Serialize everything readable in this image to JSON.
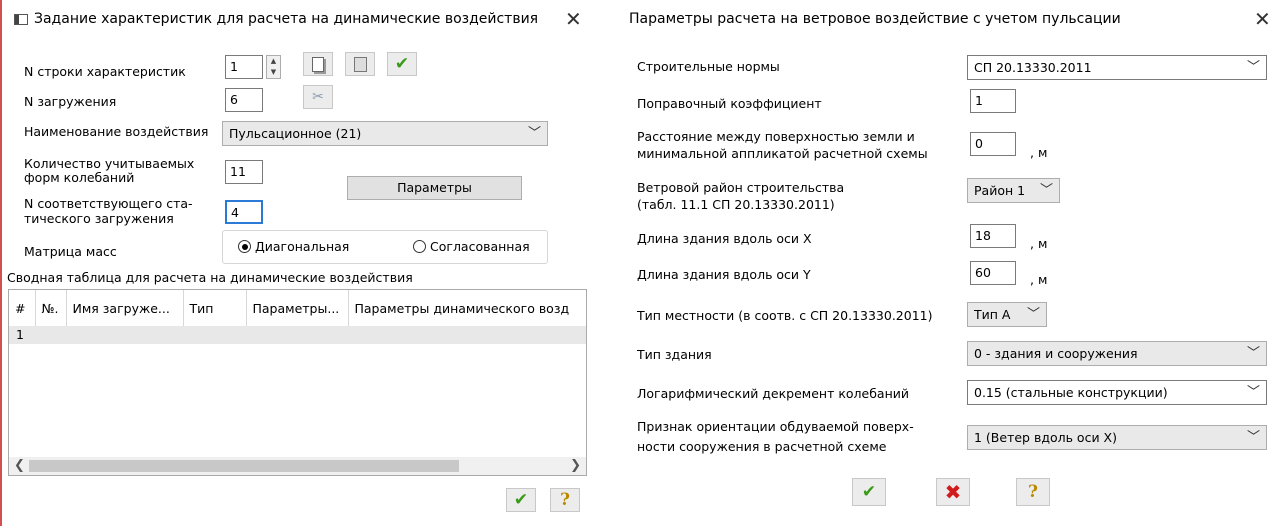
{
  "left": {
    "title": "Задание характеристик для расчета на динамические воздействия",
    "close": "✕",
    "labels": {
      "row_num": "N строки характеристик",
      "load_num": "N загружения",
      "action_name": "Наименование воздействия",
      "modes_count_1": "Количество учитываемых",
      "modes_count_2": "форм колебаний",
      "static_load_1": "N соответствующего ста-",
      "static_load_2": "тического загружения",
      "mass_matrix": "Матрица масс"
    },
    "values": {
      "row_num": "1",
      "load_num": "6",
      "action_name": "Пульсационное (21)",
      "modes_count": "11",
      "static_load": "4"
    },
    "params_button": "Параметры",
    "radio_diag": "Диагональная",
    "radio_consist": "Согласованная",
    "table_caption": "Сводная таблица для расчета на динамические воздействия",
    "table_headers": [
      "#",
      "№.",
      "Имя загруже...",
      "Тип",
      "Параметры...",
      "Параметры динамического возд"
    ],
    "table_rows": [
      [
        "1",
        "",
        "",
        "",
        "",
        ""
      ]
    ],
    "ok": "✔",
    "help": "?"
  },
  "right": {
    "title": "Параметры расчета на ветровое воздействие с учетом пульсации",
    "close": "✕",
    "labels": {
      "norms": "Строительные нормы",
      "corr": "Поправочный коэффициент",
      "dist_1": "Расстояние между поверхностью земли и",
      "dist_2": "минимальной аппликатой расчетной схемы",
      "region_1": "Ветровой район строительства",
      "region_2": "(табл. 11.1  СП 20.13330.2011)",
      "len_x": "Длина здания вдоль оси X",
      "len_y": "Длина здания вдоль оси Y",
      "terrain": "Тип местности (в соотв. с СП 20.13330.2011)",
      "building": "Тип здания",
      "decrement": "Логарифмический декремент колебаний",
      "orient_1": "Признак ориентации обдуваемой поверх-",
      "orient_2": "ности сооружения в расчетной схеме"
    },
    "values": {
      "norms": "СП 20.13330.2011",
      "corr": "1",
      "dist": "0",
      "region": "Район 1",
      "len_x": "18",
      "len_y": "60",
      "terrain": "Тип А",
      "building": "0 - здания и сооружения",
      "decrement": "0.15 (стальные конструкции)",
      "orient": "1 (Ветер вдоль оси X)"
    },
    "unit_m": ", м",
    "ok": "✔",
    "cancel": "✖",
    "help": "?"
  }
}
